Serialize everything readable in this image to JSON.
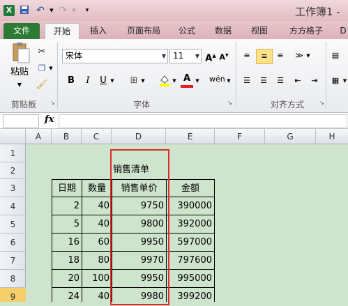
{
  "window": {
    "title": "工作簿1 -"
  },
  "quick_access": {
    "icons": [
      "excel-logo-icon",
      "save-icon",
      "undo-icon",
      "redo-icon",
      "customize-icon"
    ]
  },
  "tabs": [
    "文件",
    "开始",
    "插入",
    "页面布局",
    "公式",
    "数据",
    "视图",
    "方方格子",
    "D"
  ],
  "ribbon": {
    "clipboard": {
      "paste_label": "粘贴",
      "group_label": "剪贴板"
    },
    "font": {
      "name": "宋体",
      "size": "11",
      "group_label": "字体",
      "bold": "B",
      "italic": "I",
      "underline": "U"
    },
    "alignment": {
      "group_label": "对齐方式"
    }
  },
  "formula_bar": {
    "fx": "fx",
    "name_box": "",
    "content": ""
  },
  "columns": [
    "A",
    "B",
    "C",
    "D",
    "E",
    "F",
    "G",
    "H"
  ],
  "rows": [
    "1",
    "2",
    "3",
    "4",
    "5",
    "6",
    "7",
    "8",
    "9"
  ],
  "sheet": {
    "title": "销售清单",
    "headers": [
      "日期",
      "数量",
      "销售单价",
      "金额"
    ],
    "data": [
      [
        "2",
        "40",
        "9750",
        "390000"
      ],
      [
        "5",
        "40",
        "9800",
        "392000"
      ],
      [
        "16",
        "60",
        "9950",
        "597000"
      ],
      [
        "18",
        "80",
        "9970",
        "797600"
      ],
      [
        "20",
        "100",
        "9950",
        "995000"
      ],
      [
        "24",
        "40",
        "9980",
        "399200"
      ]
    ]
  },
  "colors": {
    "file_tab": "#2d7a35",
    "sheet_bg": "#cfe4cd",
    "highlight": "#d9302c"
  }
}
